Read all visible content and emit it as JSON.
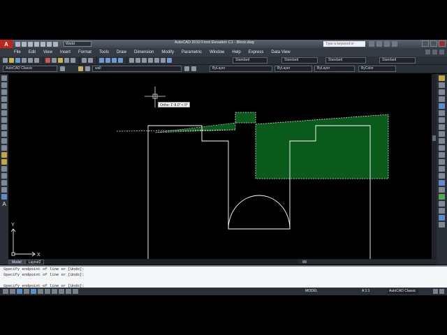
{
  "app": {
    "window_title": "AutoCAD 2010    Front Elevation C1 - Block.dwg",
    "workspace": "World",
    "search_placeholder": "Type a keyword or phrase"
  },
  "menu": [
    "File",
    "Edit",
    "View",
    "Insert",
    "Format",
    "Tools",
    "Draw",
    "Dimension",
    "Modify",
    "Parametric",
    "Window",
    "Help",
    "Express",
    "Data View"
  ],
  "styles_toolbar": {
    "text_style": "Standard",
    "dim_style": "Standard",
    "table_style": "Standard",
    "mleader_style": "Standard"
  },
  "layers_toolbar": {
    "workspace_combo": "AutoCAD Classic",
    "layer": "wall",
    "color": "ByLayer",
    "linetype": "ByLayer",
    "lineweight": "ByLayer",
    "plotstyle": "ByColor"
  },
  "canvas": {
    "ortho_tooltip": "Ortho: 1'-8.0\" < 0°",
    "ucs_x": "X",
    "ucs_y": "Y",
    "hatch_color": "#0a5a1c",
    "line_color": "#ffffff"
  },
  "tabs": [
    "Model",
    "Layout2"
  ],
  "command_history": [
    "Specify endpoint of line or [Undo]:",
    "Specify endpoint of line or [Undo]:"
  ],
  "command_input": "Specify endpoint of line or [Undo]:",
  "status": {
    "model_label": "MODEL",
    "annotation_scale": "A 1:1",
    "workspace": "AutoCAD Classic"
  },
  "left_toolbar_text": "A"
}
